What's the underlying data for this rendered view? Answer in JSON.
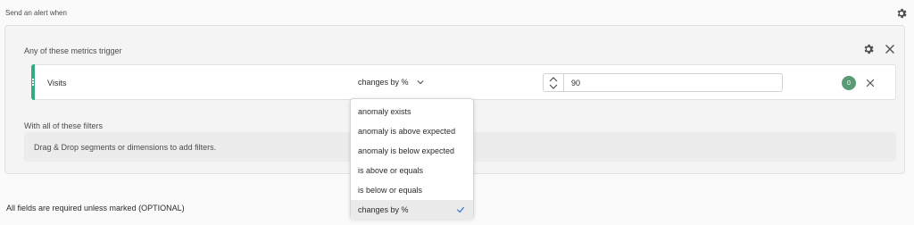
{
  "header": {
    "title": "Send an alert when",
    "gear_icon": "gear-icon"
  },
  "metrics_panel": {
    "title": "Any of these metrics trigger",
    "metric": {
      "name": "Visits",
      "condition": "changes by %",
      "value": "90",
      "badge": "0",
      "handle_color": "#33ab84"
    },
    "dropdown": {
      "options": [
        "anomaly exists",
        "anomaly is above expected",
        "anomaly is below expected",
        "is above or equals",
        "is below or equals",
        "changes by %"
      ],
      "selected": "changes by %",
      "check_color": "#2d6fd1"
    }
  },
  "filters_panel": {
    "title": "With all of these filters",
    "dropzone_text": "Drag & Drop segments or dimensions to add filters."
  },
  "footer": {
    "note": "All fields are required unless marked (OPTIONAL)"
  }
}
